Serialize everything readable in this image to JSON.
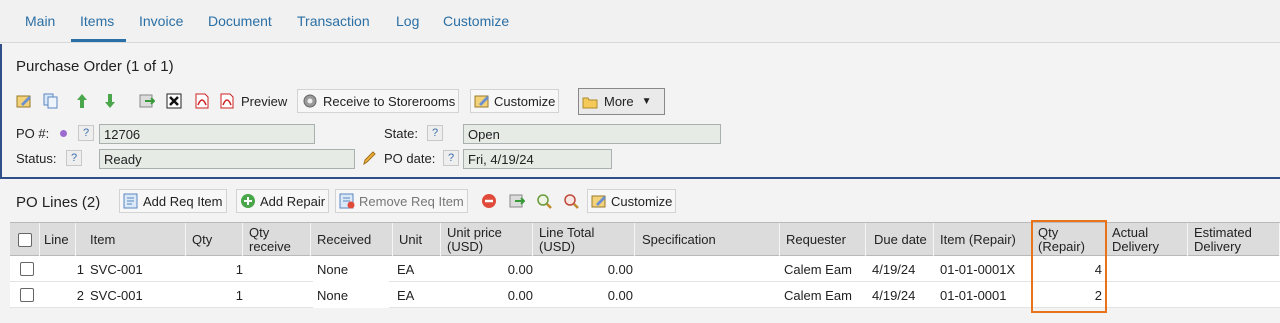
{
  "tabs": [
    {
      "label": "Main"
    },
    {
      "label": "Items"
    },
    {
      "label": "Invoice"
    },
    {
      "label": "Document"
    },
    {
      "label": "Transaction"
    },
    {
      "label": "Log"
    },
    {
      "label": "Customize"
    }
  ],
  "active_tab": "Items",
  "header": {
    "title": "Purchase Order (1 of 1)"
  },
  "toolbar": {
    "preview_label": "Preview",
    "receive_label": "Receive to Storerooms",
    "customize_label": "Customize",
    "more_label": "More"
  },
  "fields": {
    "po_label": "PO #:",
    "po_value": "12706",
    "state_label": "State:",
    "state_value": "Open",
    "status_label": "Status:",
    "status_value": "Ready",
    "po_date_label": "PO date:",
    "po_date_value": "Fri, 4/19/24",
    "help_glyph": "?"
  },
  "lines": {
    "title": "PO Lines (2)",
    "add_req_label": "Add Req Item",
    "add_repair_label": "Add Repair",
    "remove_req_label": "Remove Req Item",
    "customize_label": "Customize",
    "columns": [
      "Line",
      "Item",
      "Qty",
      "Qty receive",
      "Received",
      "Unit",
      "Unit price (USD)",
      "Line Total (USD)",
      "Specification",
      "Requester",
      "Due date",
      "Item (Repair)",
      "Qty (Repair)",
      "Actual Delivery",
      "Estimated Delivery"
    ],
    "rows": [
      {
        "line": "1",
        "item": "SVC-001",
        "qty": "1",
        "received": "None",
        "unit": "EA",
        "unit_price": "0.00",
        "line_total": "0.00",
        "requester": "Calem Eam",
        "due": "4/19/24",
        "item_repair": "01-01-0001X",
        "qty_repair": "4"
      },
      {
        "line": "2",
        "item": "SVC-001",
        "qty": "1",
        "received": "None",
        "unit": "EA",
        "unit_price": "0.00",
        "line_total": "0.00",
        "requester": "Calem Eam",
        "due": "4/19/24",
        "item_repair": "01-01-0001",
        "qty_repair": "2"
      }
    ]
  },
  "colors": {
    "accent": "#2a6fa5",
    "highlight": "#e8731a",
    "divider": "#2f4f8a"
  }
}
